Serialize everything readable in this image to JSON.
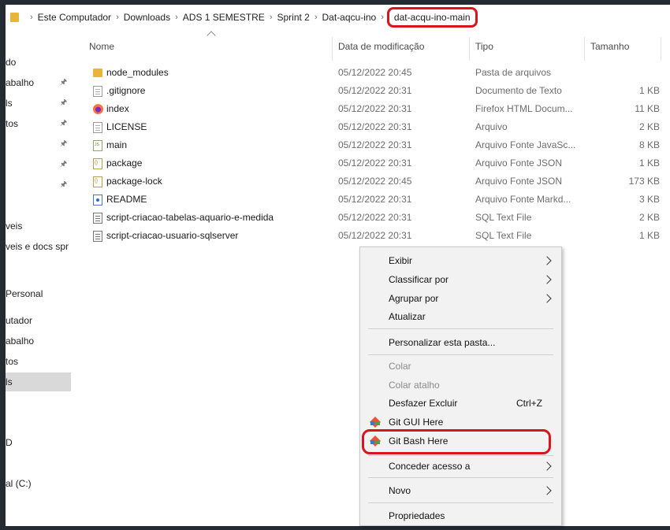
{
  "breadcrumb": {
    "items": [
      "Este Computador",
      "Downloads",
      "ADS 1 SEMESTRE",
      "Sprint 2",
      "Dat-aqcu-ino"
    ],
    "current": "dat-acqu-ino-main"
  },
  "nav": {
    "items": [
      {
        "label": "do",
        "pinned": false
      },
      {
        "label": "abalho",
        "pinned": true
      },
      {
        "label": "ls",
        "pinned": true
      },
      {
        "label": "tos",
        "pinned": true
      },
      {
        "label": "",
        "pinned": true
      },
      {
        "label": "",
        "pinned": true
      },
      {
        "label": "",
        "pinned": true
      },
      {
        "label": "veis",
        "pinned": false
      },
      {
        "label": "veis e docs spr",
        "pinned": false
      },
      {
        "label": "Personal",
        "pinned": false
      },
      {
        "label": "utador",
        "pinned": false
      },
      {
        "label": "abalho",
        "pinned": false
      },
      {
        "label": "tos",
        "pinned": false
      },
      {
        "label": "ls",
        "pinned": false
      },
      {
        "label": "D",
        "pinned": false
      },
      {
        "label": "al (C:)",
        "pinned": false
      }
    ]
  },
  "columns": {
    "name": "Nome",
    "date": "Data de modificação",
    "type": "Tipo",
    "size": "Tamanho"
  },
  "files": [
    {
      "name": "node_modules",
      "date": "05/12/2022 20:45",
      "type": "Pasta de arquivos",
      "size": "",
      "icon": "folder-icon"
    },
    {
      "name": ".gitignore",
      "date": "05/12/2022 20:31",
      "type": "Documento de Texto",
      "size": "1 KB",
      "icon": "text-file-icon"
    },
    {
      "name": "index",
      "date": "05/12/2022 20:31",
      "type": "Firefox HTML Docum...",
      "size": "11 KB",
      "icon": "firefox-html-icon"
    },
    {
      "name": "LICENSE",
      "date": "05/12/2022 20:31",
      "type": "Arquivo",
      "size": "2 KB",
      "icon": "file-icon"
    },
    {
      "name": "main",
      "date": "05/12/2022 20:31",
      "type": "Arquivo Fonte JavaSc...",
      "size": "8 KB",
      "icon": "js-file-icon"
    },
    {
      "name": "package",
      "date": "05/12/2022 20:31",
      "type": "Arquivo Fonte JSON",
      "size": "1 KB",
      "icon": "json-file-icon"
    },
    {
      "name": "package-lock",
      "date": "05/12/2022 20:45",
      "type": "Arquivo Fonte JSON",
      "size": "173 KB",
      "icon": "json-file-icon"
    },
    {
      "name": "README",
      "date": "05/12/2022 20:31",
      "type": "Arquivo Fonte Markd...",
      "size": "3 KB",
      "icon": "markdown-file-icon"
    },
    {
      "name": "script-criacao-tabelas-aquario-e-medida",
      "date": "05/12/2022 20:31",
      "type": "SQL Text File",
      "size": "2 KB",
      "icon": "sql-file-icon"
    },
    {
      "name": "script-criacao-usuario-sqlserver",
      "date": "05/12/2022 20:31",
      "type": "SQL Text File",
      "size": "1 KB",
      "icon": "sql-file-icon"
    }
  ],
  "context_menu": {
    "exibir": "Exibir",
    "classificar": "Classificar por",
    "agrupar": "Agrupar por",
    "atualizar": "Atualizar",
    "personalizar": "Personalizar esta pasta...",
    "colar": "Colar",
    "colar_atalho": "Colar atalho",
    "desfazer": "Desfazer Excluir",
    "desfazer_shortcut": "Ctrl+Z",
    "git_gui": "Git GUI Here",
    "git_bash": "Git Bash Here",
    "conceder": "Conceder acesso a",
    "novo": "Novo",
    "propriedades": "Propriedades"
  },
  "colors": {
    "highlight_red": "#d8141c",
    "folder_yellow": "#e8b53a",
    "git_orange": "#f05133",
    "git_blue": "#2f7dd1",
    "git_green": "#48a23f"
  }
}
